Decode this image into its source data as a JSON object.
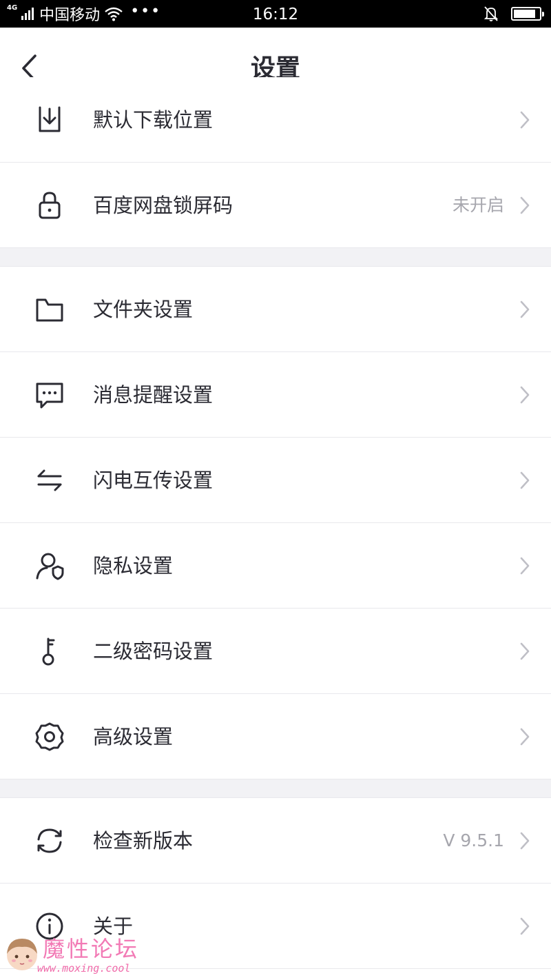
{
  "status_bar": {
    "network": "4G",
    "carrier": "中国移动",
    "more": "•••",
    "time": "16:12",
    "battery_level": 0.85
  },
  "header": {
    "title": "设置",
    "back_icon": "chevron-left-icon"
  },
  "groups": [
    [
      {
        "name": "default-download-location",
        "icon": "download-icon",
        "label": "默认下载位置",
        "value": ""
      },
      {
        "name": "lock-screen-code",
        "icon": "lock-icon",
        "label": "百度网盘锁屏码",
        "value": "未开启"
      }
    ],
    [
      {
        "name": "folder-settings",
        "icon": "folder-icon",
        "label": "文件夹设置",
        "value": ""
      },
      {
        "name": "message-settings",
        "icon": "message-icon",
        "label": "消息提醒设置",
        "value": ""
      },
      {
        "name": "transfer-settings",
        "icon": "transfer-icon",
        "label": "闪电互传设置",
        "value": ""
      },
      {
        "name": "privacy-settings",
        "icon": "privacy-icon",
        "label": "隐私设置",
        "value": ""
      },
      {
        "name": "secondary-password",
        "icon": "key-icon",
        "label": "二级密码设置",
        "value": ""
      },
      {
        "name": "advanced-settings",
        "icon": "gear-icon",
        "label": "高级设置",
        "value": ""
      }
    ],
    [
      {
        "name": "check-update",
        "icon": "refresh-icon",
        "label": "检查新版本",
        "value": "V 9.5.1"
      },
      {
        "name": "about",
        "icon": "info-icon",
        "label": "关于",
        "value": ""
      }
    ]
  ],
  "watermark": {
    "title": "魔性论坛",
    "url": "www.moxing.cool"
  },
  "colors": {
    "text": "#2b2b33",
    "muted": "#a6a6ad",
    "divider": "#e8e8ec",
    "gap": "#f2f2f5",
    "watermark": "#f27ab5"
  }
}
